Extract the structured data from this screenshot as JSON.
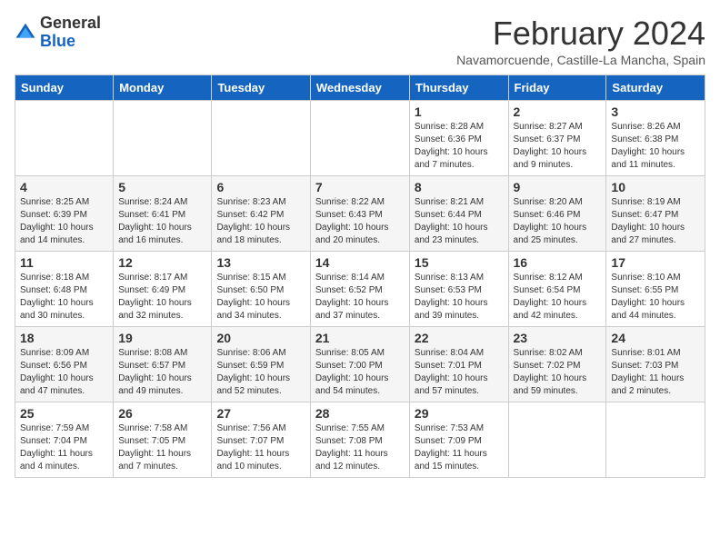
{
  "logo": {
    "text_general": "General",
    "text_blue": "Blue"
  },
  "header": {
    "month_title": "February 2024",
    "subtitle": "Navamorcuende, Castille-La Mancha, Spain"
  },
  "days_of_week": [
    "Sunday",
    "Monday",
    "Tuesday",
    "Wednesday",
    "Thursday",
    "Friday",
    "Saturday"
  ],
  "weeks": [
    [
      {
        "day": "",
        "info": ""
      },
      {
        "day": "",
        "info": ""
      },
      {
        "day": "",
        "info": ""
      },
      {
        "day": "",
        "info": ""
      },
      {
        "day": "1",
        "info": "Sunrise: 8:28 AM\nSunset: 6:36 PM\nDaylight: 10 hours and 7 minutes."
      },
      {
        "day": "2",
        "info": "Sunrise: 8:27 AM\nSunset: 6:37 PM\nDaylight: 10 hours and 9 minutes."
      },
      {
        "day": "3",
        "info": "Sunrise: 8:26 AM\nSunset: 6:38 PM\nDaylight: 10 hours and 11 minutes."
      }
    ],
    [
      {
        "day": "4",
        "info": "Sunrise: 8:25 AM\nSunset: 6:39 PM\nDaylight: 10 hours and 14 minutes."
      },
      {
        "day": "5",
        "info": "Sunrise: 8:24 AM\nSunset: 6:41 PM\nDaylight: 10 hours and 16 minutes."
      },
      {
        "day": "6",
        "info": "Sunrise: 8:23 AM\nSunset: 6:42 PM\nDaylight: 10 hours and 18 minutes."
      },
      {
        "day": "7",
        "info": "Sunrise: 8:22 AM\nSunset: 6:43 PM\nDaylight: 10 hours and 20 minutes."
      },
      {
        "day": "8",
        "info": "Sunrise: 8:21 AM\nSunset: 6:44 PM\nDaylight: 10 hours and 23 minutes."
      },
      {
        "day": "9",
        "info": "Sunrise: 8:20 AM\nSunset: 6:46 PM\nDaylight: 10 hours and 25 minutes."
      },
      {
        "day": "10",
        "info": "Sunrise: 8:19 AM\nSunset: 6:47 PM\nDaylight: 10 hours and 27 minutes."
      }
    ],
    [
      {
        "day": "11",
        "info": "Sunrise: 8:18 AM\nSunset: 6:48 PM\nDaylight: 10 hours and 30 minutes."
      },
      {
        "day": "12",
        "info": "Sunrise: 8:17 AM\nSunset: 6:49 PM\nDaylight: 10 hours and 32 minutes."
      },
      {
        "day": "13",
        "info": "Sunrise: 8:15 AM\nSunset: 6:50 PM\nDaylight: 10 hours and 34 minutes."
      },
      {
        "day": "14",
        "info": "Sunrise: 8:14 AM\nSunset: 6:52 PM\nDaylight: 10 hours and 37 minutes."
      },
      {
        "day": "15",
        "info": "Sunrise: 8:13 AM\nSunset: 6:53 PM\nDaylight: 10 hours and 39 minutes."
      },
      {
        "day": "16",
        "info": "Sunrise: 8:12 AM\nSunset: 6:54 PM\nDaylight: 10 hours and 42 minutes."
      },
      {
        "day": "17",
        "info": "Sunrise: 8:10 AM\nSunset: 6:55 PM\nDaylight: 10 hours and 44 minutes."
      }
    ],
    [
      {
        "day": "18",
        "info": "Sunrise: 8:09 AM\nSunset: 6:56 PM\nDaylight: 10 hours and 47 minutes."
      },
      {
        "day": "19",
        "info": "Sunrise: 8:08 AM\nSunset: 6:57 PM\nDaylight: 10 hours and 49 minutes."
      },
      {
        "day": "20",
        "info": "Sunrise: 8:06 AM\nSunset: 6:59 PM\nDaylight: 10 hours and 52 minutes."
      },
      {
        "day": "21",
        "info": "Sunrise: 8:05 AM\nSunset: 7:00 PM\nDaylight: 10 hours and 54 minutes."
      },
      {
        "day": "22",
        "info": "Sunrise: 8:04 AM\nSunset: 7:01 PM\nDaylight: 10 hours and 57 minutes."
      },
      {
        "day": "23",
        "info": "Sunrise: 8:02 AM\nSunset: 7:02 PM\nDaylight: 10 hours and 59 minutes."
      },
      {
        "day": "24",
        "info": "Sunrise: 8:01 AM\nSunset: 7:03 PM\nDaylight: 11 hours and 2 minutes."
      }
    ],
    [
      {
        "day": "25",
        "info": "Sunrise: 7:59 AM\nSunset: 7:04 PM\nDaylight: 11 hours and 4 minutes."
      },
      {
        "day": "26",
        "info": "Sunrise: 7:58 AM\nSunset: 7:05 PM\nDaylight: 11 hours and 7 minutes."
      },
      {
        "day": "27",
        "info": "Sunrise: 7:56 AM\nSunset: 7:07 PM\nDaylight: 11 hours and 10 minutes."
      },
      {
        "day": "28",
        "info": "Sunrise: 7:55 AM\nSunset: 7:08 PM\nDaylight: 11 hours and 12 minutes."
      },
      {
        "day": "29",
        "info": "Sunrise: 7:53 AM\nSunset: 7:09 PM\nDaylight: 11 hours and 15 minutes."
      },
      {
        "day": "",
        "info": ""
      },
      {
        "day": "",
        "info": ""
      }
    ]
  ]
}
